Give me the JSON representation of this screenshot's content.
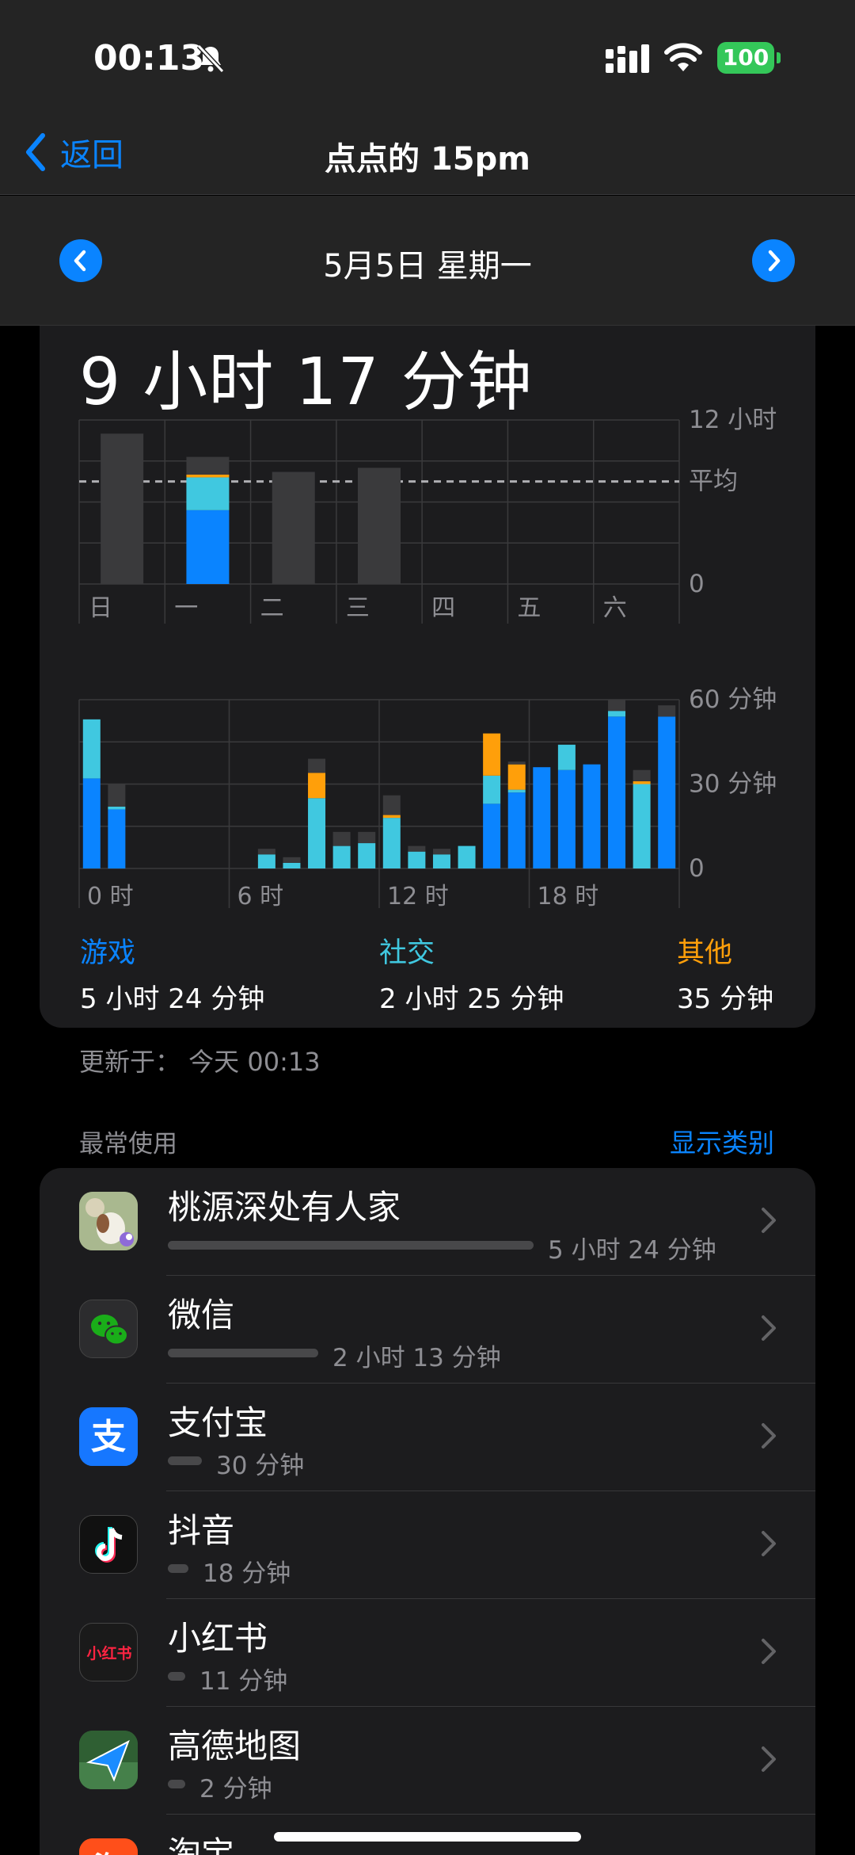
{
  "status_bar": {
    "time": "00:13",
    "battery": "100"
  },
  "nav": {
    "back_label": "返回",
    "title": "点点的 15pm"
  },
  "date_nav": {
    "date": "5月5日 星期一"
  },
  "summary": {
    "total": "9 小时 17 分钟",
    "updated": "更新于： 今天 00:13"
  },
  "colors": {
    "games": "#0a84ff",
    "social": "#40c8e0",
    "other": "#ff9f0a",
    "bar_gray": "#3a3a3c",
    "accent": "#0a84ff"
  },
  "chart_data": [
    {
      "type": "bar",
      "title": "",
      "categories": [
        "日",
        "一",
        "二",
        "三",
        "四",
        "五",
        "六"
      ],
      "y_tick_labels": [
        "12 小时",
        "平均",
        "0"
      ],
      "ylim": [
        0,
        12
      ],
      "average_hours": 7.5,
      "series": [
        {
          "name": "游戏",
          "values": [
            0,
            5.4,
            0,
            0,
            0,
            0,
            0
          ]
        },
        {
          "name": "社交",
          "values": [
            0,
            2.4,
            0,
            0,
            0,
            0,
            0
          ]
        },
        {
          "name": "其他",
          "values": [
            0,
            0.2,
            0,
            0,
            0,
            0,
            0
          ]
        },
        {
          "values": [
            11.0,
            1.3,
            8.2,
            8.5,
            0,
            0,
            0
          ]
        }
      ]
    },
    {
      "type": "bar",
      "title": "",
      "x": [
        0,
        1,
        2,
        3,
        4,
        5,
        6,
        7,
        8,
        9,
        10,
        11,
        12,
        13,
        14,
        15,
        16,
        17,
        18,
        19,
        20,
        21,
        22,
        23
      ],
      "x_tick_labels": [
        "0 时",
        "6 时",
        "12 时",
        "18 时"
      ],
      "y_tick_labels": [
        "60 分钟",
        "30 分钟",
        "0"
      ],
      "ylim": [
        0,
        60
      ],
      "series": [
        {
          "name": "游戏",
          "values": [
            32,
            21,
            0,
            0,
            0,
            0,
            0,
            0,
            0,
            0,
            0,
            0,
            0,
            0,
            0,
            0,
            23,
            27,
            36,
            35,
            37,
            54,
            0,
            54
          ]
        },
        {
          "name": "社交",
          "values": [
            21,
            1,
            0,
            0,
            0,
            0,
            0,
            5,
            2,
            25,
            8,
            9,
            18,
            6,
            5,
            8,
            10,
            1,
            0,
            9,
            0,
            2,
            30,
            0
          ]
        },
        {
          "name": "其他",
          "values": [
            0,
            0,
            0,
            0,
            0,
            0,
            0,
            0,
            0,
            9,
            0,
            0,
            1,
            0,
            0,
            0,
            15,
            9,
            0,
            0,
            0,
            0,
            1,
            0
          ]
        },
        {
          "values": [
            0,
            8,
            0,
            0,
            0,
            0,
            0,
            2,
            2,
            5,
            5,
            4,
            7,
            2,
            2,
            0,
            0,
            1,
            0,
            0,
            0,
            4,
            4,
            4
          ]
        }
      ]
    }
  ],
  "categories_summary": [
    {
      "label": "游戏",
      "value": "5 小时 24 分钟"
    },
    {
      "label": "社交",
      "value": "2 小时 25 分钟"
    },
    {
      "label": "其他",
      "value": "35 分钟"
    }
  ],
  "most_used": {
    "header": "最常使用",
    "link": "显示类别",
    "apps": [
      {
        "name": "桃源深处有人家",
        "duration": "5 小时 24 分钟",
        "minutes": 324,
        "icon": "game-app-icon"
      },
      {
        "name": "微信",
        "duration": "2 小时 13 分钟",
        "minutes": 133,
        "icon": "wechat-icon"
      },
      {
        "name": "支付宝",
        "duration": "30 分钟",
        "minutes": 30,
        "icon": "alipay-icon"
      },
      {
        "name": "抖音",
        "duration": "18 分钟",
        "minutes": 18,
        "icon": "douyin-icon"
      },
      {
        "name": "小红书",
        "duration": "11 分钟",
        "minutes": 11,
        "icon": "xiaohongshu-icon",
        "icon_text": "小红书"
      },
      {
        "name": "高德地图",
        "duration": "2 分钟",
        "minutes": 2,
        "icon": "amap-icon"
      },
      {
        "name": "淘宝",
        "duration": "",
        "minutes": 0,
        "icon": "taobao-icon",
        "icon_text": "淘"
      }
    ]
  }
}
